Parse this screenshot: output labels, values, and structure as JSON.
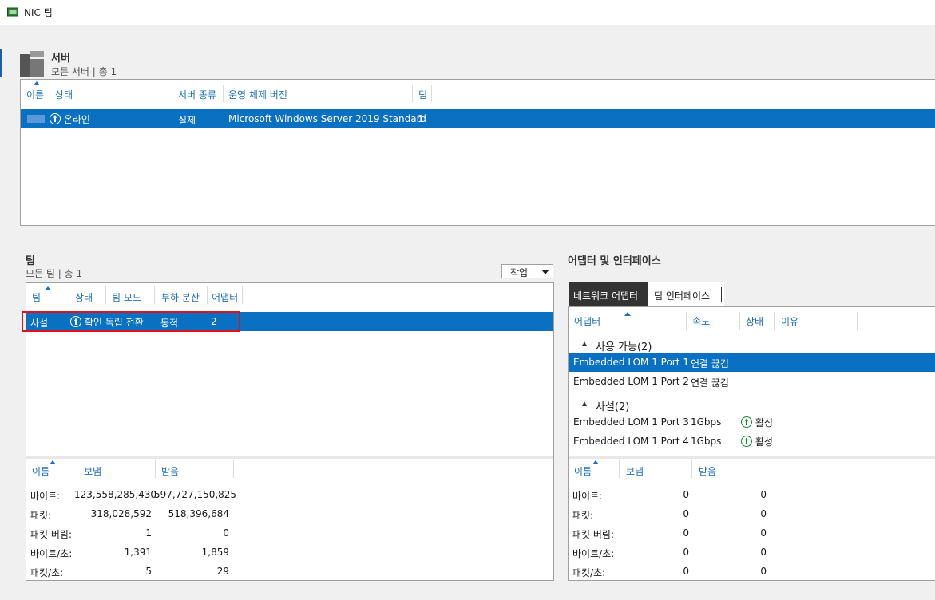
{
  "window": {
    "title": "NIC 팀"
  },
  "servers": {
    "title": "서버",
    "subtitle": "모든 서버 | 총 1",
    "columns": [
      "이름",
      "상태",
      "서버 종류",
      "운영 체제 버전",
      "팀"
    ],
    "row": {
      "name": "",
      "status": "온라인",
      "type": "실제",
      "os": "Microsoft Windows Server 2019 Standard",
      "teams": "1"
    }
  },
  "teams": {
    "title": "팀",
    "subtitle": "모든 팀 | 총 1",
    "tasks_label": "작업",
    "columns": [
      "팀",
      "상태",
      "팀 모드",
      "부하 분산",
      "어댑터"
    ],
    "row": {
      "team": "사설",
      "status": "확인 독립 전환",
      "lb": "동적",
      "adapters": "2"
    },
    "stats_columns": [
      "이름",
      "보냄",
      "받음"
    ],
    "stats": [
      {
        "label": "바이트:",
        "sent": "123,558,285,430",
        "recv": "597,727,150,825"
      },
      {
        "label": "패킷:",
        "sent": "318,028,592",
        "recv": "518,396,684"
      },
      {
        "label": "패킷 버림:",
        "sent": "1",
        "recv": "0"
      },
      {
        "label": "바이트/초:",
        "sent": "1,391",
        "recv": "1,859"
      },
      {
        "label": "패킷/초:",
        "sent": "5",
        "recv": "29"
      }
    ]
  },
  "adapters": {
    "title": "어댑터 및 인터페이스",
    "tabs": [
      "네트워크 어댑터",
      "팀 인터페이스"
    ],
    "columns": [
      "어댑터",
      "속도",
      "상태",
      "이유"
    ],
    "groups": [
      {
        "label": "사용 가능(2)",
        "rows": [
          {
            "name": "Embedded LOM 1 Port 1",
            "speed": "연결 끊김",
            "status": ""
          },
          {
            "name": "Embedded LOM 1 Port 2",
            "speed": "연결 끊김",
            "status": ""
          }
        ]
      },
      {
        "label": "사설(2)",
        "rows": [
          {
            "name": "Embedded LOM 1 Port 3",
            "speed": "1Gbps",
            "status": "활성"
          },
          {
            "name": "Embedded LOM 1 Port 4",
            "speed": "1Gbps",
            "status": "활성"
          }
        ]
      }
    ],
    "stats_columns": [
      "이름",
      "보냄",
      "받음"
    ],
    "stats": [
      {
        "label": "바이트:",
        "sent": "0",
        "recv": "0"
      },
      {
        "label": "패킷:",
        "sent": "0",
        "recv": "0"
      },
      {
        "label": "패킷 버림:",
        "sent": "0",
        "recv": "0"
      },
      {
        "label": "바이트/초:",
        "sent": "0",
        "recv": "0"
      },
      {
        "label": "패킷/초:",
        "sent": "0",
        "recv": "0"
      }
    ]
  },
  "colors": {
    "accent": "#0a70c2",
    "header_text": "#1e6fb8",
    "highlight_border": "#e0101e",
    "ok_green": "#1c8a2e"
  }
}
